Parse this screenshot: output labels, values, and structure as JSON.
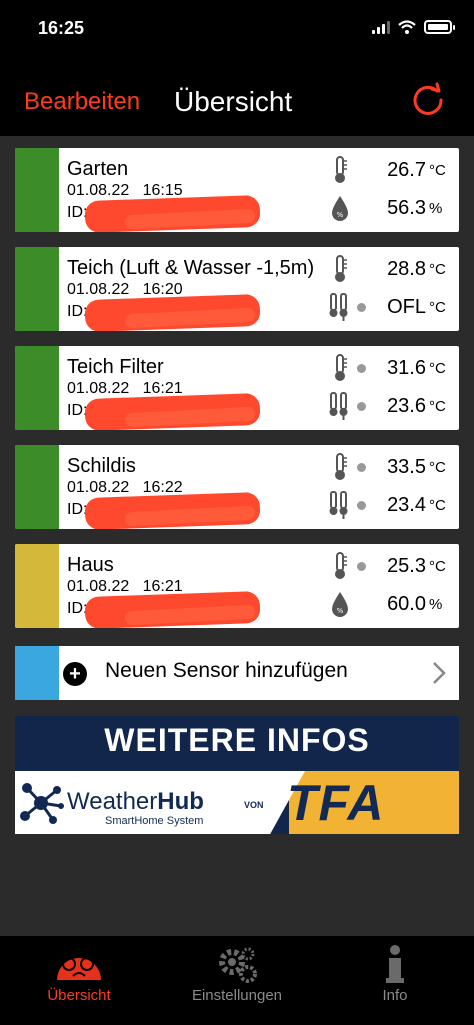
{
  "status_bar": {
    "time": "16:25"
  },
  "nav": {
    "edit_label": "Bearbeiten",
    "title": "Übersicht"
  },
  "sensors": [
    {
      "name": "Garten",
      "date": "01.08.22   16:15",
      "id_label": "ID:",
      "color": "#3c8d2a",
      "readings": [
        {
          "icon": "thermometer-icon",
          "value": "26.7",
          "unit": "°C",
          "dot": false
        },
        {
          "icon": "humidity-icon",
          "value": "56.3",
          "unit": "%",
          "dot": false
        }
      ]
    },
    {
      "name": "Teich (Luft & Wasser -1,5m)",
      "date": "01.08.22   16:20",
      "id_label": "ID:",
      "color": "#3c8d2a",
      "readings": [
        {
          "icon": "thermometer-icon",
          "value": "28.8",
          "unit": "°C",
          "dot": false
        },
        {
          "icon": "probe-icon",
          "value": "OFL",
          "unit": "°C",
          "dot": true
        }
      ]
    },
    {
      "name": "Teich Filter",
      "date": "01.08.22   16:21",
      "id_label": "ID:",
      "color": "#3c8d2a",
      "readings": [
        {
          "icon": "thermometer-icon",
          "value": "31.6",
          "unit": "°C",
          "dot": true
        },
        {
          "icon": "probe-icon",
          "value": "23.6",
          "unit": "°C",
          "dot": true
        }
      ]
    },
    {
      "name": "Schildis",
      "date": "01.08.22   16:22",
      "id_label": "ID:",
      "color": "#3c8d2a",
      "readings": [
        {
          "icon": "thermometer-icon",
          "value": "33.5",
          "unit": "°C",
          "dot": true
        },
        {
          "icon": "probe-icon",
          "value": "23.4",
          "unit": "°C",
          "dot": true
        }
      ]
    },
    {
      "name": "Haus",
      "date": "01.08.22   16:21",
      "id_label": "ID:",
      "color": "#d4b83a",
      "readings": [
        {
          "icon": "thermometer-icon",
          "value": "25.3",
          "unit": "°C",
          "dot": true
        },
        {
          "icon": "humidity-icon",
          "value": "60.0",
          "unit": "%",
          "dot": false
        }
      ]
    }
  ],
  "add_sensor": {
    "label": "Neuen Sensor hinzufügen"
  },
  "banner": {
    "headline": "WEITERE INFOS",
    "brand_light": "Weather",
    "brand_bold": "Hub",
    "subtitle": "SmartHome System",
    "von": "VON",
    "tfa": "TFA"
  },
  "tabs": [
    {
      "label": "Übersicht",
      "icon": "gauge-icon",
      "active": true
    },
    {
      "label": "Einstellungen",
      "icon": "gears-icon",
      "active": false
    },
    {
      "label": "Info",
      "icon": "info-icon",
      "active": false
    }
  ],
  "colors": {
    "accent": "#ff3b1f",
    "add_strip": "#3aa7e0",
    "inactive_tab": "#8a8a8a"
  }
}
